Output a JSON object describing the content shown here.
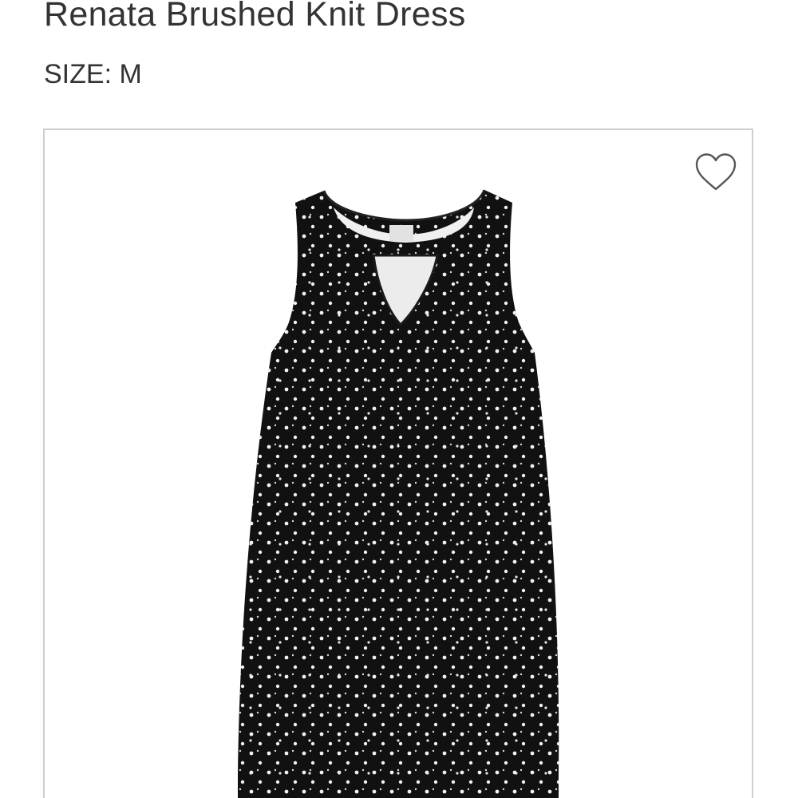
{
  "product": {
    "title": "Renata Brushed Knit Dress",
    "size_line": "SIZE: M"
  },
  "favorite": {
    "icon": "heart-icon",
    "state": "not-favorited",
    "color": "#555555"
  },
  "photo": {
    "subject": "dress-photo",
    "dress_color": "#111111",
    "dot_color": "#f2f2f2"
  },
  "colors": {
    "text": "#333333",
    "border": "#cfcfcf",
    "background": "#ffffff"
  }
}
